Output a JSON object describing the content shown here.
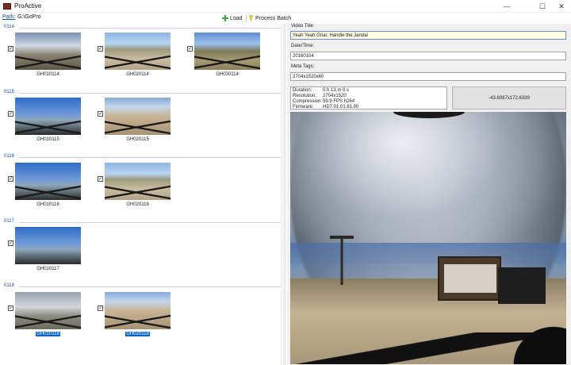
{
  "window": {
    "title": "ProActive",
    "minimize": "—",
    "maximize": "☐",
    "close": "✕"
  },
  "toolbar": {
    "path_label": "Path:",
    "path_value": "G:\\GoPro",
    "load_label": "Load",
    "batch_label": "Process Batch"
  },
  "groups": [
    {
      "label": "0114",
      "items": [
        {
          "name": "GH010114",
          "checked": true,
          "selected": false
        },
        {
          "name": "GH020114",
          "checked": true,
          "selected": false
        },
        {
          "name": "GH030114",
          "checked": true,
          "selected": false
        }
      ]
    },
    {
      "label": "0115",
      "items": [
        {
          "name": "GH010115",
          "checked": true,
          "selected": false
        },
        {
          "name": "GH020115",
          "checked": true,
          "selected": false
        }
      ]
    },
    {
      "label": "0116",
      "items": [
        {
          "name": "GH010116",
          "checked": true,
          "selected": false
        },
        {
          "name": "GH020116",
          "checked": true,
          "selected": false
        }
      ]
    },
    {
      "label": "0117",
      "items": [
        {
          "name": "GH010117",
          "checked": true,
          "selected": false
        }
      ]
    },
    {
      "label": "0118",
      "items": [
        {
          "name": "GH010118",
          "checked": true,
          "selected": true
        },
        {
          "name": "GH020118",
          "checked": true,
          "selected": true
        }
      ]
    }
  ],
  "details": {
    "video_title_label": "Video Title",
    "video_title_value": "Yeah Yeah Gnar, Handle the Jandal",
    "datetime_label": "Date/Time:",
    "datetime_value": "20160104",
    "metatags_label": "Meta Tags:",
    "metatags_value": "2704x1520x60",
    "info": {
      "duration_key": "Duration:",
      "duration_val": "0 h 13 m 0 s",
      "resolution_key": "Resolution:",
      "resolution_val": "2704x1520",
      "compression_key": "Compression:",
      "compression_val": "59.9 FPS h264",
      "firmware_key": "Firmware:",
      "firmware_val": "HD7.01.01.61.00"
    },
    "coordinates": "-43.6087x172.6339"
  },
  "playback": {
    "position_fraction": 0.0
  }
}
